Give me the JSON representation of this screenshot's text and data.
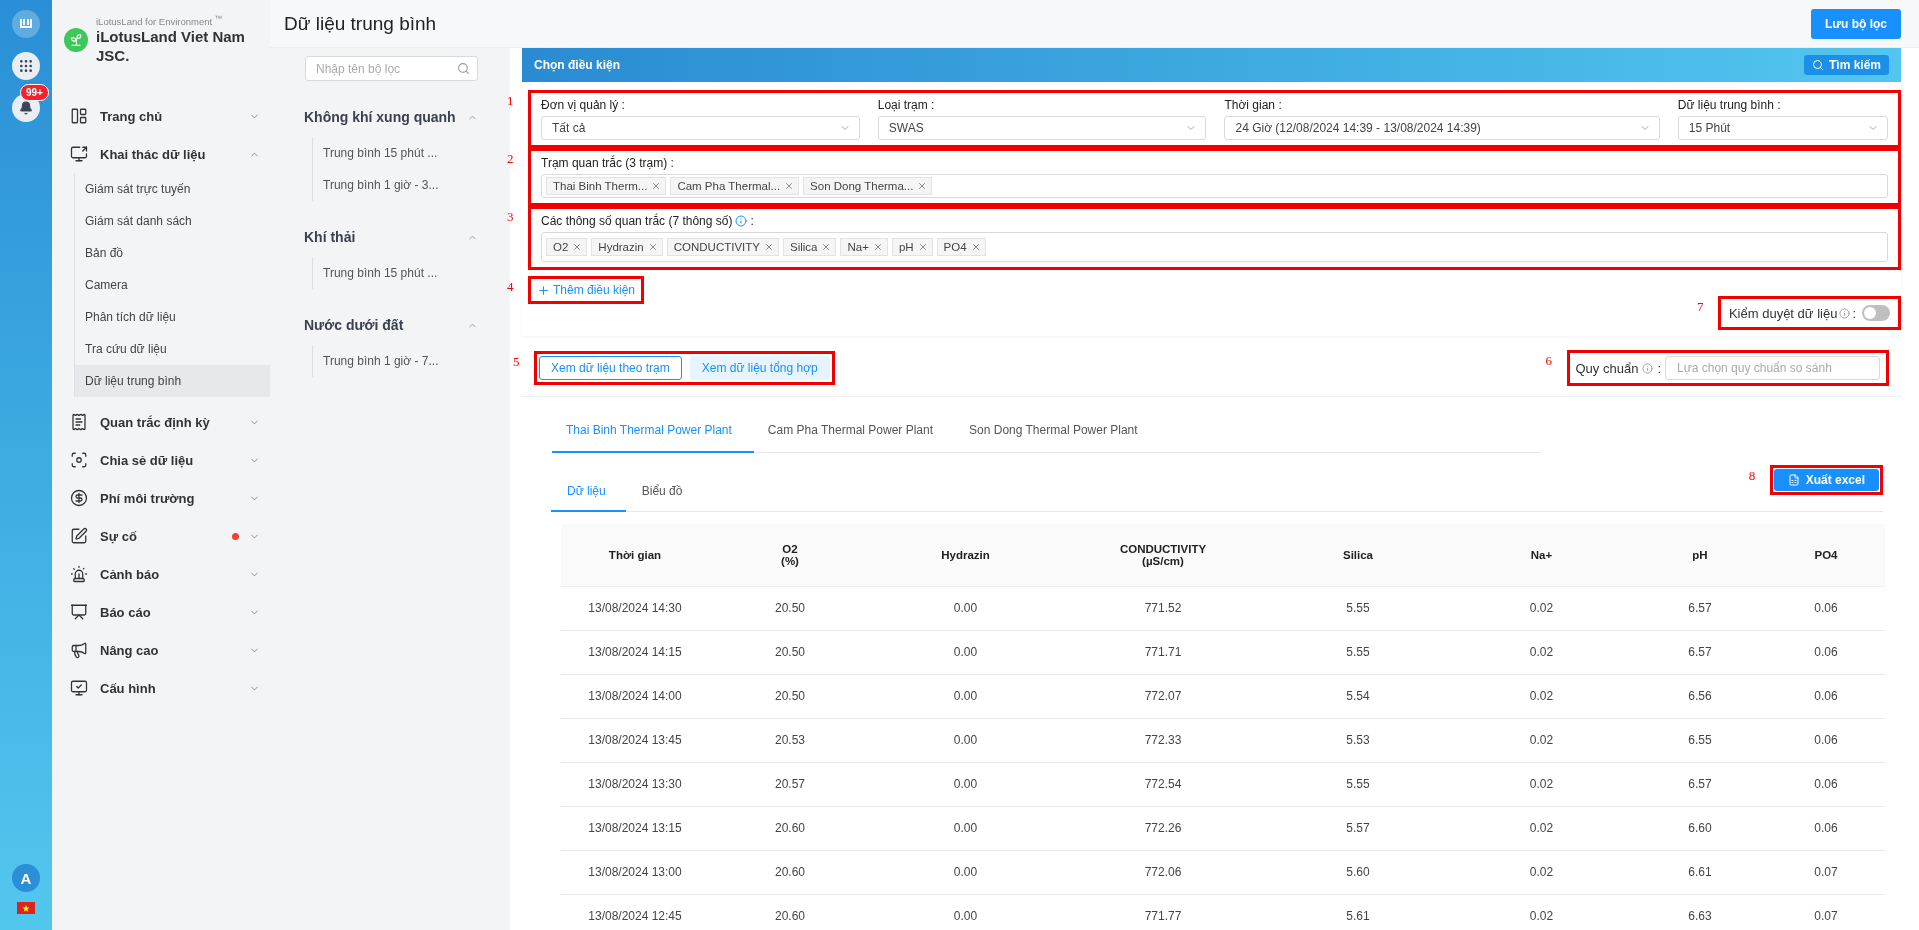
{
  "rail": {
    "notification_badge": "99+",
    "avatar": "A"
  },
  "sidebar": {
    "brand_subtitle": "iLotusLand for Environment $^{™}$",
    "brand_name": "iLotusLand Viet Nam JSC.",
    "items": [
      {
        "label": "Trang chủ",
        "expanded": false,
        "alert": false
      },
      {
        "label": "Khai thác dữ liệu",
        "expanded": true,
        "alert": false,
        "children": [
          {
            "label": "Giám sát trực tuyến",
            "selected": false
          },
          {
            "label": "Giám sát danh sách",
            "selected": false
          },
          {
            "label": "Bản đồ",
            "selected": false
          },
          {
            "label": "Camera",
            "selected": false
          },
          {
            "label": "Phân tích dữ liệu",
            "selected": false
          },
          {
            "label": "Tra cứu dữ liệu",
            "selected": false
          },
          {
            "label": "Dữ liệu trung bình",
            "selected": true
          }
        ]
      },
      {
        "label": "Quan trắc định kỳ",
        "expanded": false,
        "alert": false
      },
      {
        "label": "Chia sẻ dữ liệu",
        "expanded": false,
        "alert": false
      },
      {
        "label": "Phí môi trường",
        "expanded": false,
        "alert": false
      },
      {
        "label": "Sự cố",
        "expanded": false,
        "alert": true
      },
      {
        "label": "Cảnh báo",
        "expanded": false,
        "alert": false
      },
      {
        "label": "Báo cáo",
        "expanded": false,
        "alert": false
      },
      {
        "label": "Nâng cao",
        "expanded": false,
        "alert": false
      },
      {
        "label": "Cấu hình",
        "expanded": false,
        "alert": false
      }
    ]
  },
  "header": {
    "title": "Dữ liệu trung bình",
    "save_button": "Lưu bộ lọc"
  },
  "filters": {
    "search_placeholder": "Nhập tên bộ lọc",
    "groups": [
      {
        "title": "Không khí xung quanh",
        "expanded": true,
        "items": [
          "Trung bình 15 phút ...",
          "Trung bình 1 giờ - 3..."
        ]
      },
      {
        "title": "Khí thải",
        "expanded": true,
        "items": [
          "Trung bình 15 phút ..."
        ]
      },
      {
        "title": "Nước dưới đất",
        "expanded": true,
        "items": [
          "Trung bình 1 giờ - 7..."
        ]
      }
    ]
  },
  "conditions": {
    "title": "Chọn điều kiện",
    "search_button": "Tìm kiếm",
    "selects": {
      "marker": "1",
      "fields": [
        {
          "label": "Đơn vị quản lý :",
          "value": "Tất cả"
        },
        {
          "label": "Loại trạm :",
          "value": "SWAS"
        },
        {
          "label": "Thời gian :",
          "value": "24 Giờ (12/08/2024 14:39 - 13/08/2024 14:39)"
        },
        {
          "label": "Dữ liệu trung bình :",
          "value": "15 Phút"
        }
      ]
    },
    "stations": {
      "marker": "2",
      "label": "Trạm quan trắc (3 trạm) :",
      "tags": [
        "Thai Binh Therm...",
        "Cam Pha Thermal...",
        "Son Dong Therma..."
      ]
    },
    "parameters": {
      "marker": "3",
      "label": "Các thông số quan trắc (7 thông số)",
      "suffix": ":",
      "tags": [
        "O2",
        "Hydrazin",
        "CONDUCTIVITY",
        "Silica",
        "Na+",
        "pH",
        "PO4"
      ]
    },
    "add_condition": {
      "marker": "4",
      "label": "Thêm điều kiện"
    },
    "approval": {
      "marker": "7",
      "label": "Kiểm duyệt dữ liệu",
      "suffix": ":",
      "on": false
    }
  },
  "view_buttons": {
    "marker": "5",
    "items": [
      {
        "label": "Xem dữ liệu theo trạm",
        "selected": true
      },
      {
        "label": "Xem dữ liệu tổng hợp",
        "selected": false
      }
    ]
  },
  "standard": {
    "marker": "6",
    "label": "Quy chuẩn",
    "suffix": ":",
    "placeholder": "Lựa chọn quy chuẩn so sánh"
  },
  "station_tabs": [
    {
      "label": "Thai Binh Thermal Power Plant",
      "selected": true
    },
    {
      "label": "Cam Pha Thermal Power Plant",
      "selected": false
    },
    {
      "label": "Son Dong Thermal Power Plant",
      "selected": false
    }
  ],
  "view_tabs": [
    {
      "label": "Dữ liệu",
      "selected": true
    },
    {
      "label": "Biểu đồ",
      "selected": false
    }
  ],
  "export_button": {
    "marker": "8",
    "label": "Xuất excel"
  },
  "table": {
    "columns": [
      {
        "name": "Thời gian"
      },
      {
        "name": "O2",
        "unit": "(%)"
      },
      {
        "name": "Hydrazin"
      },
      {
        "name": "CONDUCTIVITY",
        "unit": "(µS/cm)"
      },
      {
        "name": "Silica"
      },
      {
        "name": "Na+"
      },
      {
        "name": "pH"
      },
      {
        "name": "PO4"
      }
    ],
    "rows": [
      [
        "13/08/2024 14:30",
        "20.50",
        "0.00",
        "771.52",
        "5.55",
        "0.02",
        "6.57",
        "0.06"
      ],
      [
        "13/08/2024 14:15",
        "20.50",
        "0.00",
        "771.71",
        "5.55",
        "0.02",
        "6.57",
        "0.06"
      ],
      [
        "13/08/2024 14:00",
        "20.50",
        "0.00",
        "772.07",
        "5.54",
        "0.02",
        "6.56",
        "0.06"
      ],
      [
        "13/08/2024 13:45",
        "20.53",
        "0.00",
        "772.33",
        "5.53",
        "0.02",
        "6.55",
        "0.06"
      ],
      [
        "13/08/2024 13:30",
        "20.57",
        "0.00",
        "772.54",
        "5.55",
        "0.02",
        "6.57",
        "0.06"
      ],
      [
        "13/08/2024 13:15",
        "20.60",
        "0.00",
        "772.26",
        "5.57",
        "0.02",
        "6.60",
        "0.06"
      ],
      [
        "13/08/2024 13:00",
        "20.60",
        "0.00",
        "772.06",
        "5.60",
        "0.02",
        "6.61",
        "0.07"
      ],
      [
        "13/08/2024 12:45",
        "20.60",
        "0.00",
        "771.77",
        "5.61",
        "0.02",
        "6.63",
        "0.07"
      ]
    ]
  }
}
